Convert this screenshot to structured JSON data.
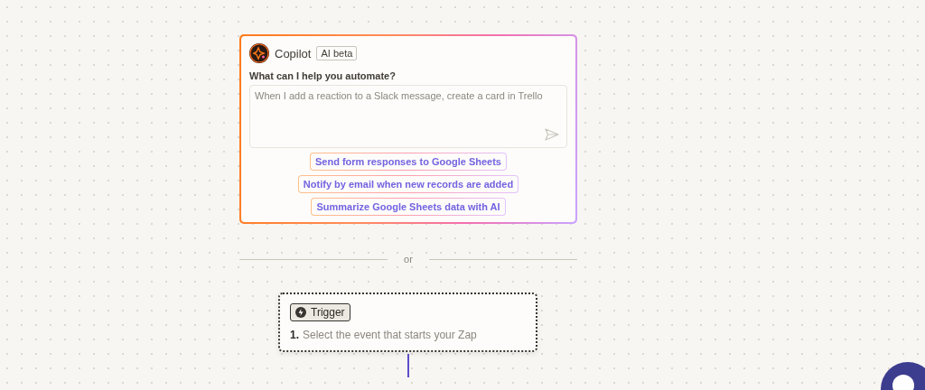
{
  "copilot": {
    "title": "Copilot",
    "badge": "AI beta",
    "prompt_label": "What can I help you automate?",
    "input": {
      "placeholder": "When I add a reaction to a Slack message, create a card in Trello"
    },
    "suggestions": [
      "Send form responses to Google Sheets",
      "Notify by email when new records are added",
      "Summarize Google Sheets data with AI"
    ]
  },
  "divider": {
    "label": "or"
  },
  "trigger": {
    "label": "Trigger",
    "step_number": "1.",
    "description": "Select the event that starts your Zap"
  }
}
